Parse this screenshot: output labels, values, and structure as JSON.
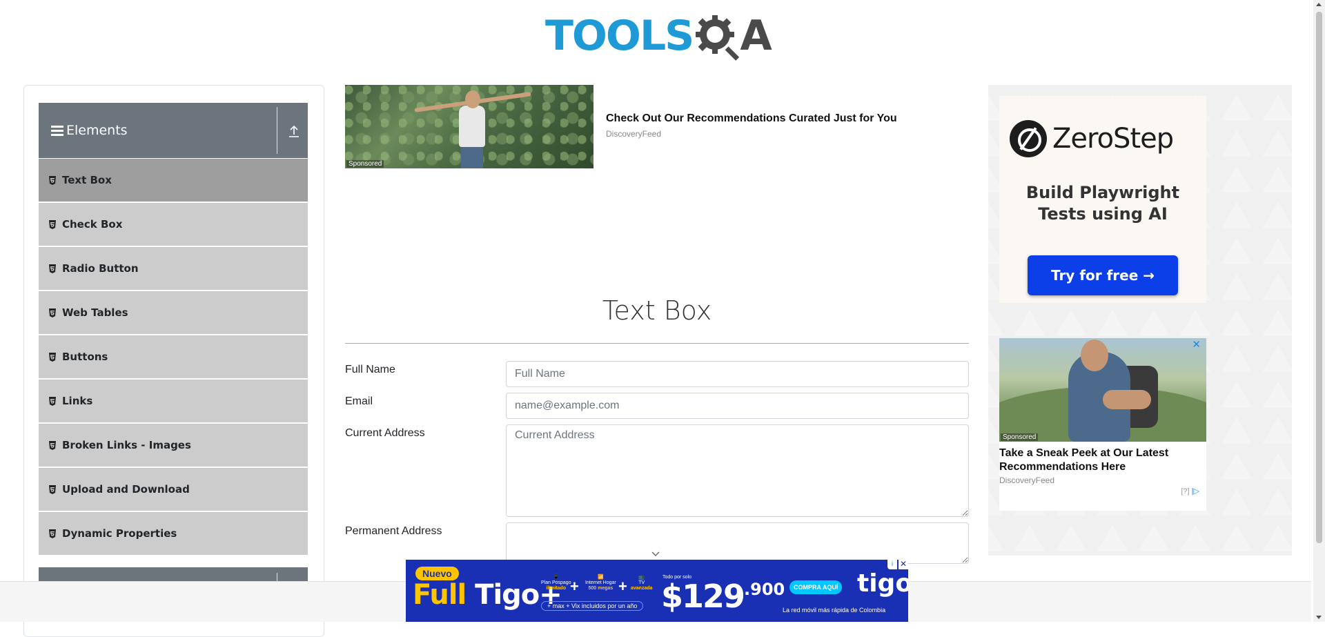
{
  "header": {
    "logo_tools": "TOOLS",
    "logo_a": "A",
    "logo_alt": "TOOLSQA"
  },
  "sidebar": {
    "group_title": "Elements",
    "items": [
      {
        "label": "Text Box",
        "active": true
      },
      {
        "label": "Check Box",
        "active": false
      },
      {
        "label": "Radio Button",
        "active": false
      },
      {
        "label": "Web Tables",
        "active": false
      },
      {
        "label": "Buttons",
        "active": false
      },
      {
        "label": "Links",
        "active": false
      },
      {
        "label": "Broken Links - Images",
        "active": false
      },
      {
        "label": "Upload and Download",
        "active": false
      },
      {
        "label": "Dynamic Properties",
        "active": false
      }
    ]
  },
  "top_ad": {
    "sponsored": "Sponsored",
    "title": "Check Out Our Recommendations Curated Just for You",
    "source": "DiscoveryFeed"
  },
  "main": {
    "heading": "Text Box",
    "fields": {
      "full_name_label": "Full Name",
      "full_name_placeholder": "Full Name",
      "email_label": "Email",
      "email_placeholder": "name@example.com",
      "current_address_label": "Current Address",
      "current_address_placeholder": "Current Address",
      "permanent_address_label": "Permanent Address",
      "permanent_address_value": ""
    }
  },
  "right_ads": {
    "zerostep": {
      "brand": "ZeroStep",
      "subtitle_line1": "Build Playwright",
      "subtitle_line2": "Tests using AI",
      "cta": "Try for free →"
    },
    "discovery": {
      "sponsored": "Sponsored",
      "title": "Take a Sneak Peek at Our Latest Recommendations Here",
      "source": "DiscoveryFeed",
      "close": "✕",
      "info": "[?]"
    }
  },
  "banner": {
    "nuevo": "Nuevo",
    "full": "Full",
    "tigo_plus": "Tigo+",
    "feat1_top": "Plan Pospago",
    "feat1_bold": "ilimitado",
    "feat2_top": "Internet Hogar",
    "feat2_bold": "500 megas",
    "feat3_top": "TV",
    "feat3_bold": "avanzada",
    "extras": "+ max + Vix incluidos por un año",
    "todo": "Todo por solo",
    "price_main": "$129",
    "price_sup": ".900",
    "cta": "COMPRA AQUÍ",
    "brand": "tigo",
    "tagline": "La red móvil más rápida de Colombia",
    "close": "✕",
    "adinfo": "i"
  },
  "colors": {
    "brand_blue": "#1e9ad6",
    "sidebar_header": "#6c757d",
    "menu_item": "#cccccc",
    "menu_active": "#9e9e9e",
    "zerostep_button": "#0d3fe8",
    "tigo_blue": "#1930b4"
  }
}
